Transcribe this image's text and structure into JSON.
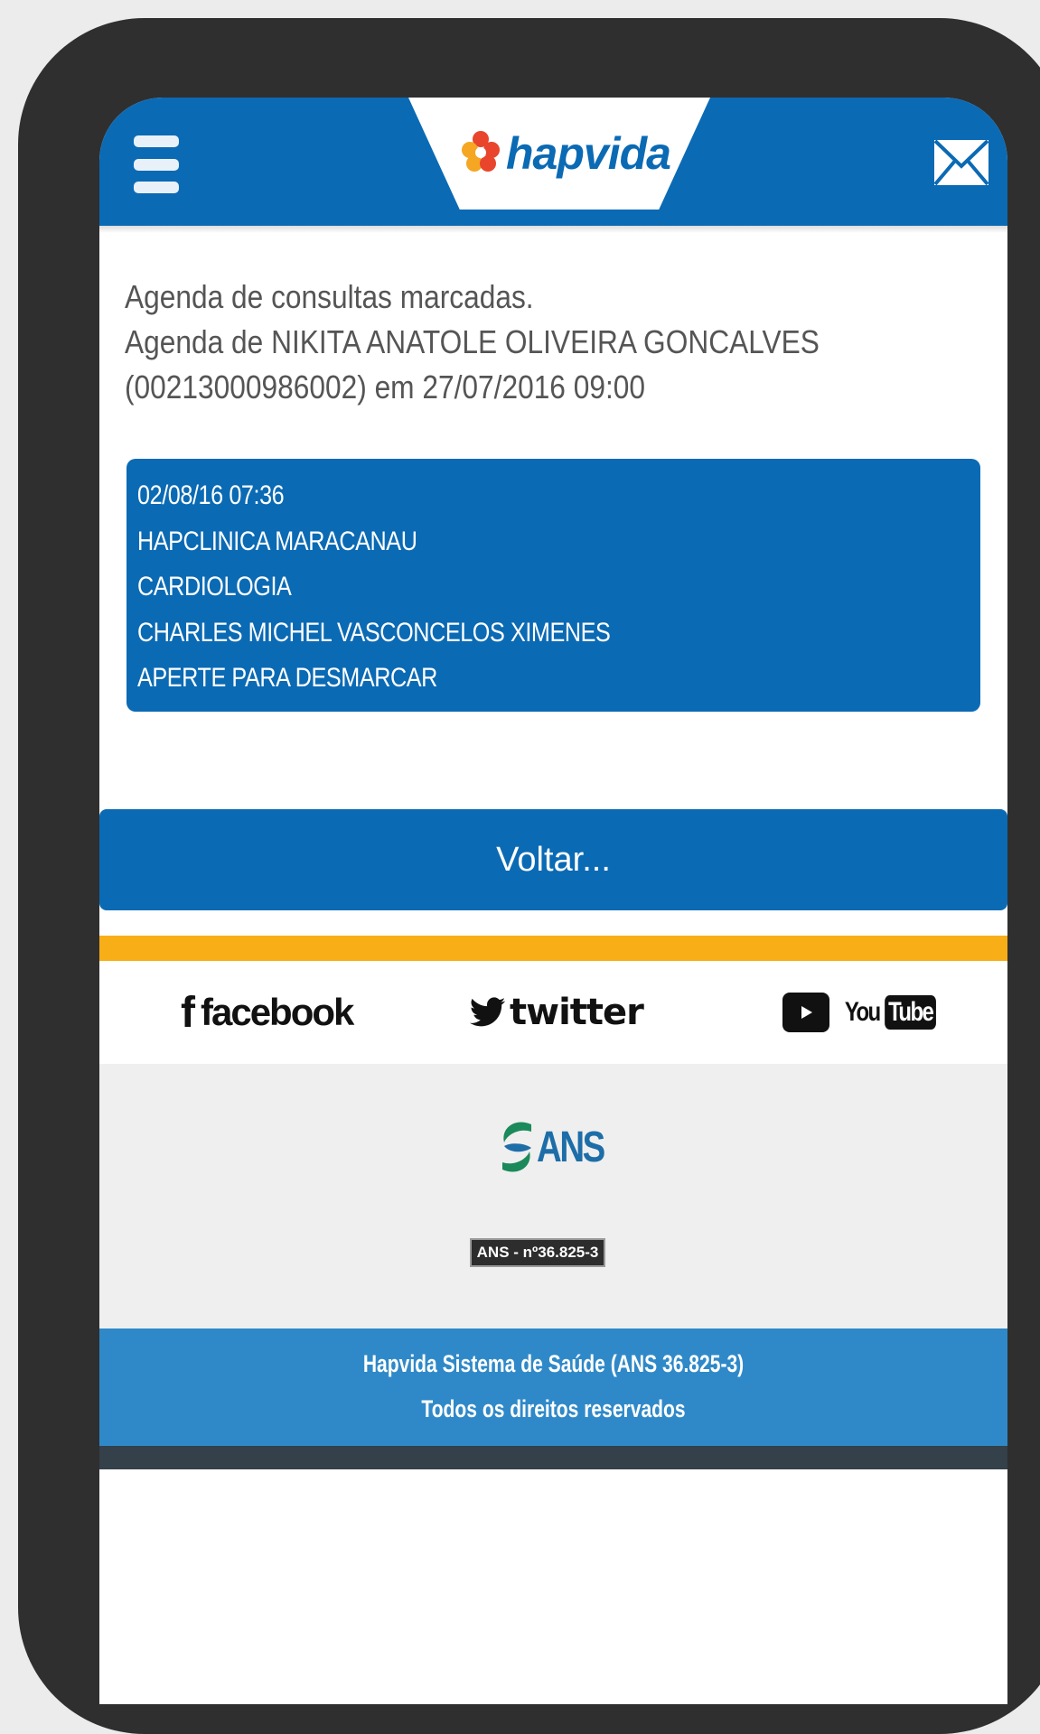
{
  "header": {
    "menu_icon": "hamburger-menu-icon",
    "brand": "hapvida",
    "mail_icon": "envelope-icon",
    "colors": {
      "primary": "#0b6ab4",
      "accent": "#f8ae17"
    }
  },
  "intro": {
    "line1": "Agenda de consultas marcadas.",
    "line2": "Agenda de NIKITA ANATOLE OLIVEIRA GONCALVES",
    "line3": "(00213000986002) em 27/07/2016 09:00"
  },
  "appointment": {
    "datetime": "02/08/16 07:36",
    "clinic": "HAPCLINICA MARACANAU",
    "specialty": "CARDIOLOGIA",
    "doctor": "CHARLES MICHEL VASCONCELOS XIMENES",
    "action": "APERTE PARA DESMARCAR"
  },
  "back_button": "Voltar...",
  "social": {
    "facebook_glyph": "f",
    "facebook": "facebook",
    "twitter": "twitter",
    "youtube_you": "You",
    "youtube_tube": "Tube"
  },
  "ans": {
    "logo_text": "ANS",
    "badge": "ANS - nº36.825-3"
  },
  "footer": {
    "line1": "Hapvida Sistema de Saúde (ANS 36.825-3)",
    "line2": "Todos os direitos reservados"
  }
}
